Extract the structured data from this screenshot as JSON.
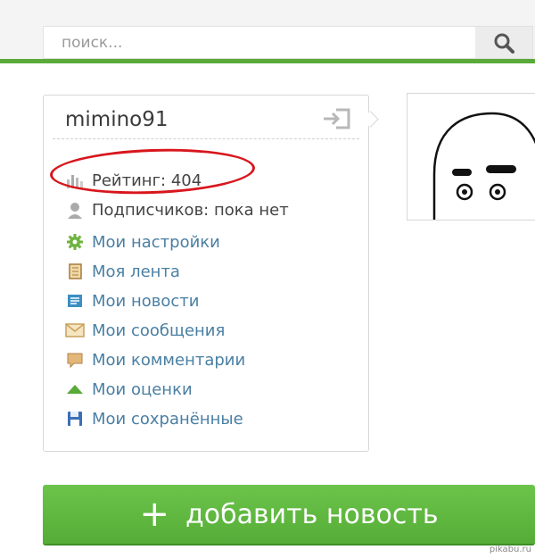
{
  "search": {
    "placeholder": "поиск..."
  },
  "profile": {
    "username": "mimino91",
    "rating": "Рейтинг: 404",
    "subscribers": "Подписчиков: пока нет",
    "menu": [
      {
        "label": "Мои настройки",
        "icon": "gear-icon"
      },
      {
        "label": "Моя лента",
        "icon": "scroll-icon"
      },
      {
        "label": "Мои новости",
        "icon": "news-icon"
      },
      {
        "label": "Мои сообщения",
        "icon": "envelope-icon"
      },
      {
        "label": "Мои комментарии",
        "icon": "comment-icon"
      },
      {
        "label": "Мои оценки",
        "icon": "triangle-up-icon"
      },
      {
        "label": "Мои сохранённые",
        "icon": "floppy-icon"
      }
    ]
  },
  "add_button": {
    "plus": "+",
    "label": "добавить новость"
  },
  "watermark": "pikabu.ru",
  "colors": {
    "accent": "#5aaa3a",
    "link": "#4a7fa3",
    "annotation": "#d8161d"
  }
}
